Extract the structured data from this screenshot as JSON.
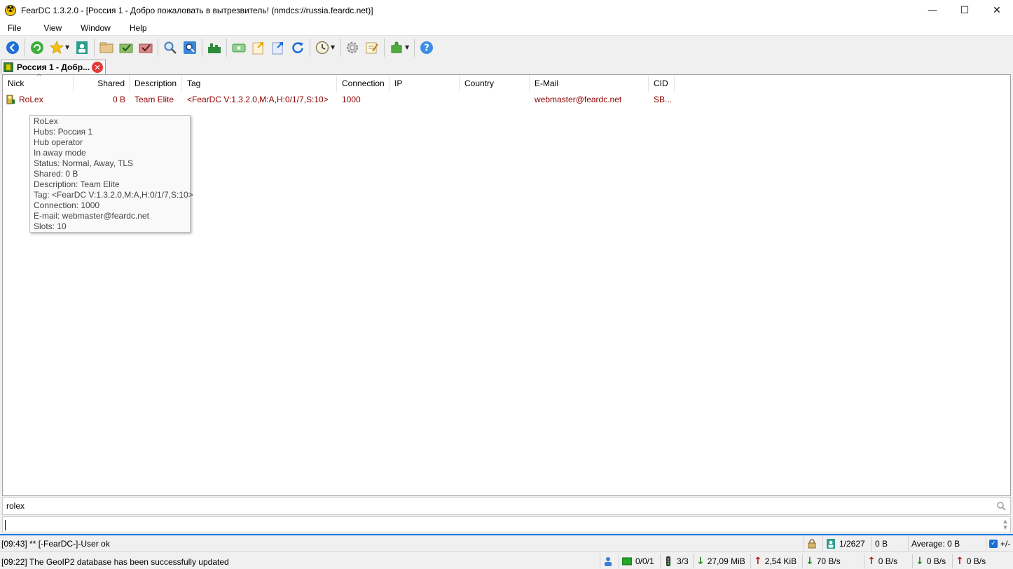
{
  "window": {
    "title": "FearDC 1.3.2.0 - [Россия 1 - Добро пожаловать в вытрезвитель! (nmdcs://russia.feardc.net)]",
    "minimize_glyph": "—",
    "maximize_glyph": "☐",
    "close_glyph": "✕"
  },
  "menu": {
    "file": "File",
    "view": "View",
    "window": "Window",
    "help": "Help"
  },
  "tab": {
    "label": "Россия 1 - Добр...",
    "close_glyph": "✕"
  },
  "columns": {
    "nick": "Nick",
    "shared": "Shared",
    "description": "Description",
    "tag": "Tag",
    "connection": "Connection",
    "ip": "IP",
    "country": "Country",
    "email": "E-Mail",
    "cid": "CID",
    "sort_arrow": "^"
  },
  "users": [
    {
      "nick": "RoLex",
      "shared": "0 B",
      "description": "Team Elite",
      "tag": "<FearDC V:1.3.2.0,M:A,H:0/1/7,S:10>",
      "connection": "1000",
      "ip": "",
      "country": "",
      "email": "webmaster@feardc.net",
      "cid": "SB..."
    }
  ],
  "tooltip": {
    "lines": [
      "RoLex",
      "Hubs: Россия 1",
      "Hub operator",
      "In away mode",
      "Status: Normal, Away, TLS",
      "Shared: 0 B",
      "Description: Team Elite",
      "Tag: <FearDC V:1.3.2.0,M:A,H:0/1/7,S:10>",
      "Connection: 1000",
      "E-mail: webmaster@feardc.net",
      "Slots: 10"
    ]
  },
  "filter": {
    "value": "rolex"
  },
  "status": {
    "line1": "[09:43] ** [-FearDC-]-User ok",
    "line2": "[09:22] The GeoIP2 database has been successfully updated",
    "users_count": "1/2627",
    "hub_share": "0 B",
    "average": "Average: 0 B",
    "plus_minus": "+/-",
    "slots": "0/0/1",
    "hubs": "3/3",
    "downloaded": "27,09 MiB",
    "uploaded": "2,54 KiB",
    "down_speed": "70 B/s",
    "up_speed": "0 B/s",
    "down_limit": "0 B/s",
    "up_limit": "0 B/s"
  },
  "colors": {
    "user_text": "#8b0000",
    "accent": "#0078d7"
  }
}
